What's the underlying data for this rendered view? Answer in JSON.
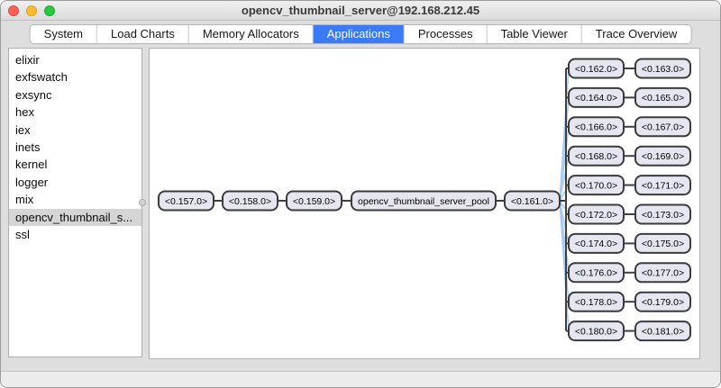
{
  "window": {
    "title": "opencv_thumbnail_server@192.168.212.45",
    "traffic_lights": [
      {
        "name": "close",
        "color": "#ff5f57"
      },
      {
        "name": "minimize",
        "color": "#febc2e"
      },
      {
        "name": "zoom",
        "color": "#28c840"
      }
    ]
  },
  "tabs": [
    {
      "label": "System",
      "selected": false
    },
    {
      "label": "Load Charts",
      "selected": false
    },
    {
      "label": "Memory Allocators",
      "selected": false
    },
    {
      "label": "Applications",
      "selected": true
    },
    {
      "label": "Processes",
      "selected": false
    },
    {
      "label": "Table Viewer",
      "selected": false
    },
    {
      "label": "Trace Overview",
      "selected": false
    }
  ],
  "sidebar": {
    "items": [
      {
        "label": "elixir",
        "selected": false
      },
      {
        "label": "exfswatch",
        "selected": false
      },
      {
        "label": "exsync",
        "selected": false
      },
      {
        "label": "hex",
        "selected": false
      },
      {
        "label": "iex",
        "selected": false
      },
      {
        "label": "inets",
        "selected": false
      },
      {
        "label": "kernel",
        "selected": false
      },
      {
        "label": "logger",
        "selected": false
      },
      {
        "label": "mix",
        "selected": false
      },
      {
        "label": "opencv_thumbnail_s...",
        "selected": true
      },
      {
        "label": "ssl",
        "selected": false
      }
    ]
  },
  "diagram": {
    "type": "process-tree",
    "chain": [
      "<0.157.0>",
      "<0.158.0>",
      "<0.159.0>",
      "opencv_thumbnail_server_pool",
      "<0.161.0>"
    ],
    "fanout_parent": "<0.161.0>",
    "workers": [
      [
        "<0.162.0>",
        "<0.163.0>"
      ],
      [
        "<0.164.0>",
        "<0.165.0>"
      ],
      [
        "<0.166.0>",
        "<0.167.0>"
      ],
      [
        "<0.168.0>",
        "<0.169.0>"
      ],
      [
        "<0.170.0>",
        "<0.171.0>"
      ],
      [
        "<0.172.0>",
        "<0.173.0>"
      ],
      [
        "<0.174.0>",
        "<0.175.0>"
      ],
      [
        "<0.176.0>",
        "<0.177.0>"
      ],
      [
        "<0.178.0>",
        "<0.179.0>"
      ],
      [
        "<0.180.0>",
        "<0.181.0>"
      ]
    ],
    "colors": {
      "node_fill": "#e6e6f1",
      "node_border": "#3b3b3b",
      "tree_line": "#3f3f3f",
      "link_line": "#a9cdf2"
    }
  },
  "colors": {
    "selected_tab": "#3a7af5"
  }
}
